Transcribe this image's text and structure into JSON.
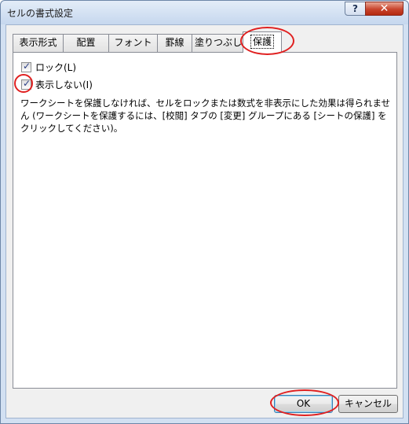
{
  "window": {
    "title": "セルの書式設定",
    "help_glyph": "?",
    "close_glyph": "✕"
  },
  "tabs": [
    {
      "label": "表示形式"
    },
    {
      "label": "配置"
    },
    {
      "label": "フォント"
    },
    {
      "label": "罫線"
    },
    {
      "label": "塗りつぶし"
    },
    {
      "label": "保護"
    }
  ],
  "active_tab": "保護",
  "protection": {
    "lock_label": "ロック(L)",
    "lock_checked": true,
    "hide_label": "表示しない(I)",
    "hide_checked": true,
    "description": "ワークシートを保護しなければ、セルをロックまたは数式を非表示にした効果は得られません (ワークシートを保護するには、[校閲] タブの [変更] グループにある [シートの保護] をクリックしてください)。",
    "check_glyph": "✓"
  },
  "buttons": {
    "ok": "OK",
    "cancel": "キャンセル"
  },
  "annotations": {
    "color": "#e02020"
  }
}
